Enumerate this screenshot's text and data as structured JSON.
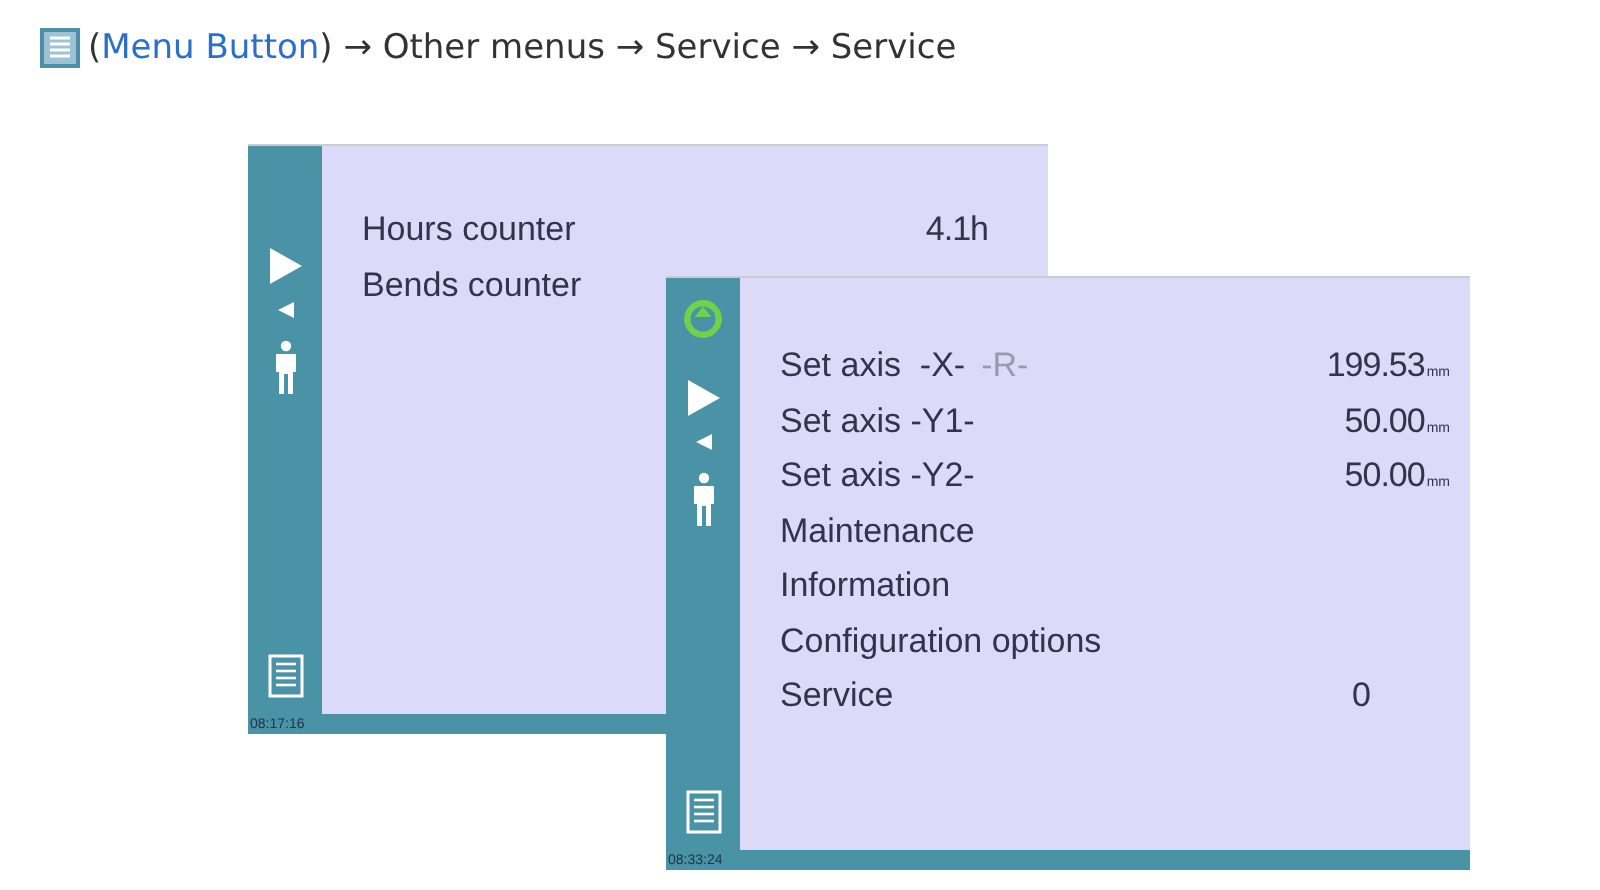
{
  "heading": {
    "before": "(",
    "link": "Menu Button",
    "after": ") → Other menus → Service → Service"
  },
  "screens": [
    {
      "time": "08:17:16",
      "rows": [
        {
          "label": "Hours counter",
          "value": "4.1h"
        },
        {
          "label": "Bends counter"
        }
      ]
    },
    {
      "time": "08:33:24",
      "status_icon": true,
      "rows": [
        {
          "label": "Set axis  -X-",
          "extra": "-R-",
          "value": "199.53",
          "unit": "mm"
        },
        {
          "label": "Set axis -Y1-",
          "value": "50.00",
          "unit": "mm"
        },
        {
          "label": "Set axis -Y2-",
          "value": "50.00",
          "unit": "mm"
        },
        {
          "label": "Maintenance"
        },
        {
          "label": "Information"
        },
        {
          "label": "Configuration options"
        },
        {
          "label": "Service",
          "value": "0"
        }
      ]
    }
  ]
}
